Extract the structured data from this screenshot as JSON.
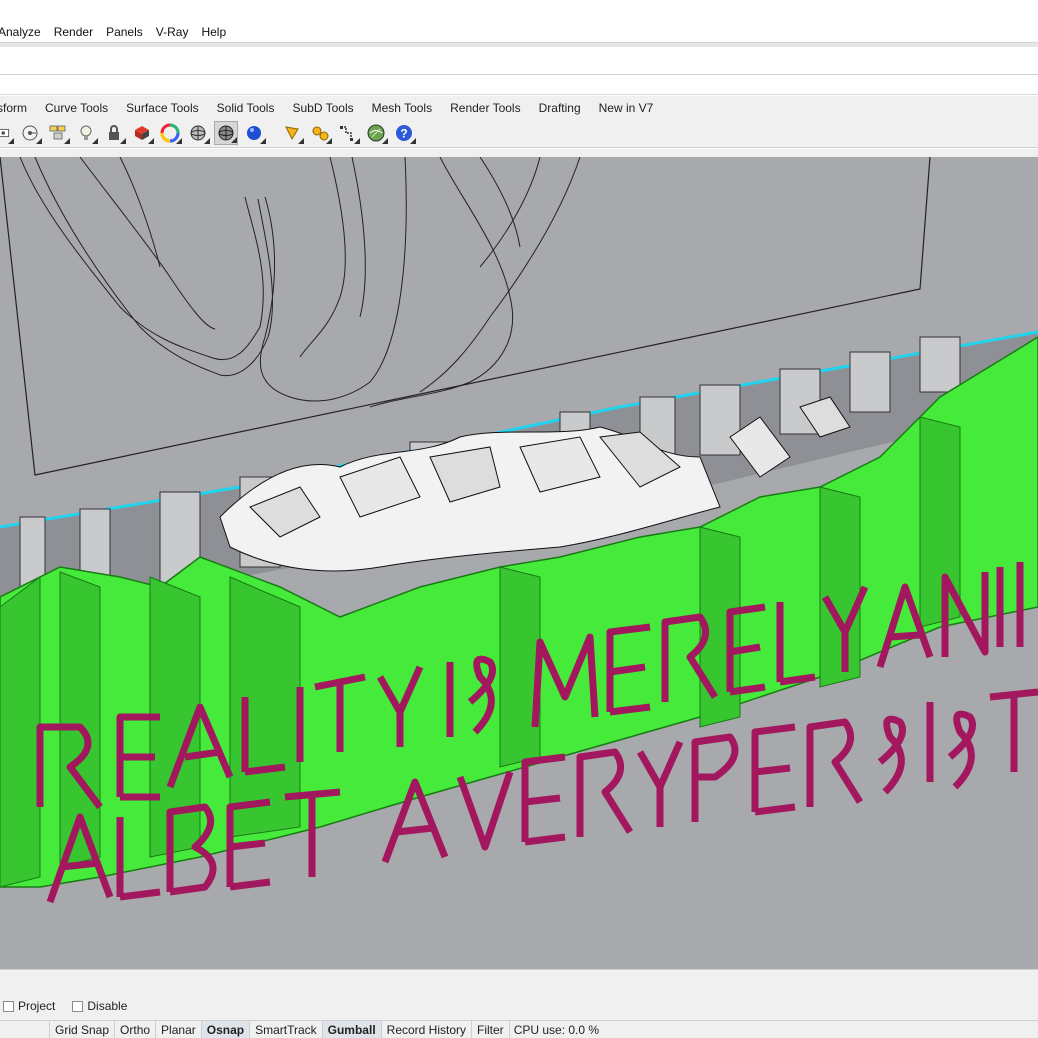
{
  "menu": [
    "Analyze",
    "Render",
    "Panels",
    "V-Ray",
    "Help"
  ],
  "tabs": [
    "sform",
    "Curve Tools",
    "Surface Tools",
    "Solid Tools",
    "SubD Tools",
    "Mesh Tools",
    "Render Tools",
    "Drafting",
    "New in V7"
  ],
  "toolbar_icons": [
    "select-filter-icon",
    "snapshot-icon",
    "layers-icon",
    "light-bulb-icon",
    "lock-icon",
    "material-icon",
    "color-wheel-icon",
    "wireframe-sphere-icon",
    "shaded-sphere-icon",
    "rendered-sphere-icon",
    "sun-icon",
    "gears-icon",
    "grid-snap-icon",
    "globe-icon",
    "help-icon"
  ],
  "viewport": {
    "background": "#a7a9ad",
    "text_line_1": "REALITY IS MERELY AN ILLUSION",
    "text_line_2": "ALBERT A VERY PERSISTENT",
    "accent_green": "#3df23d",
    "accent_magenta": "#a3175e",
    "accent_cyan": "#22d3ee"
  },
  "osnap": {
    "project_label": "Project",
    "disable_label": "Disable"
  },
  "status": {
    "panes": [
      "Grid Snap",
      "Ortho",
      "Planar",
      "Osnap",
      "SmartTrack",
      "Gumball",
      "Record History",
      "Filter"
    ],
    "bold_panes": [
      "Osnap",
      "Gumball"
    ],
    "cpu": "CPU use: 0.0 %"
  }
}
